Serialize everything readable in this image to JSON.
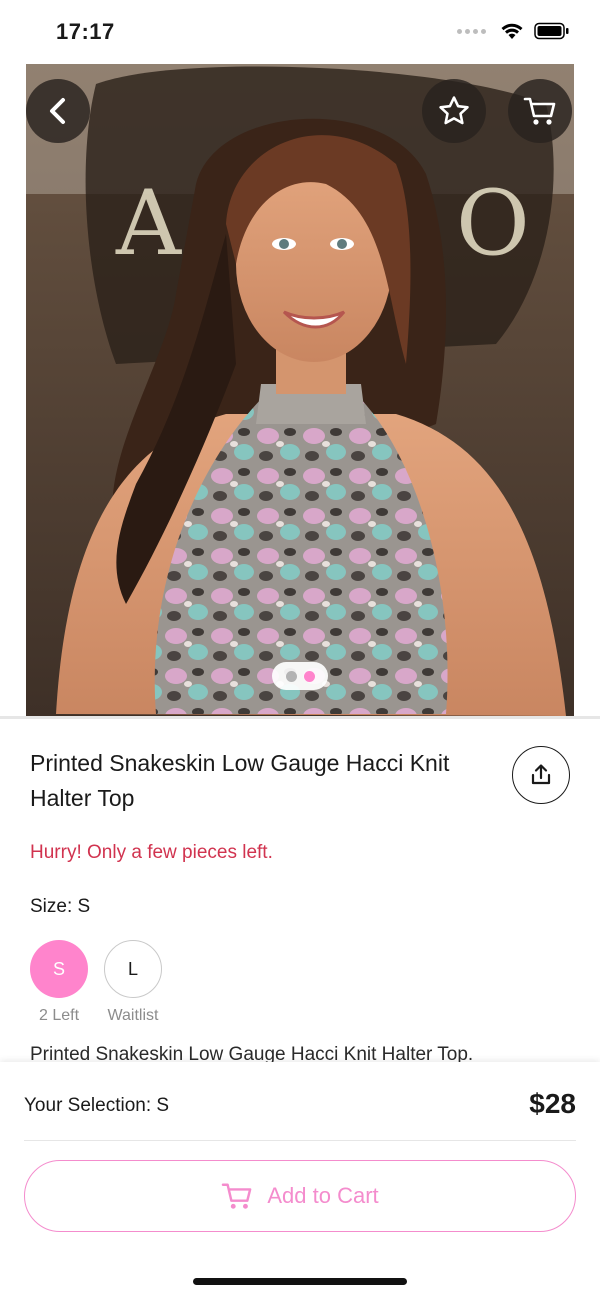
{
  "status_bar": {
    "time": "17:17"
  },
  "product": {
    "title": "Printed Snakeskin Low Gauge Hacci Knit Halter Top",
    "stock_alert": "Hurry! Only a few pieces left.",
    "size_label": "Size: S",
    "sizes": [
      {
        "label": "S",
        "note": "2 Left",
        "selected": true
      },
      {
        "label": "L",
        "note": "Waitlist",
        "selected": false
      }
    ],
    "description": "Printed Snakeskin Low Gauge Hacci Knit Halter Top."
  },
  "gallery": {
    "page_count": 2,
    "active_page": 2
  },
  "footer": {
    "selection_label": "Your Selection: S",
    "price": "$28",
    "add_to_cart_label": "Add to Cart"
  },
  "colors": {
    "accent_pink": "#ff84cc",
    "button_pink": "#f48ccd",
    "alert_red": "#d1334f"
  },
  "icons": {
    "back": "chevron-left-icon",
    "favorite": "star-icon",
    "cart": "cart-icon",
    "share": "share-icon"
  }
}
